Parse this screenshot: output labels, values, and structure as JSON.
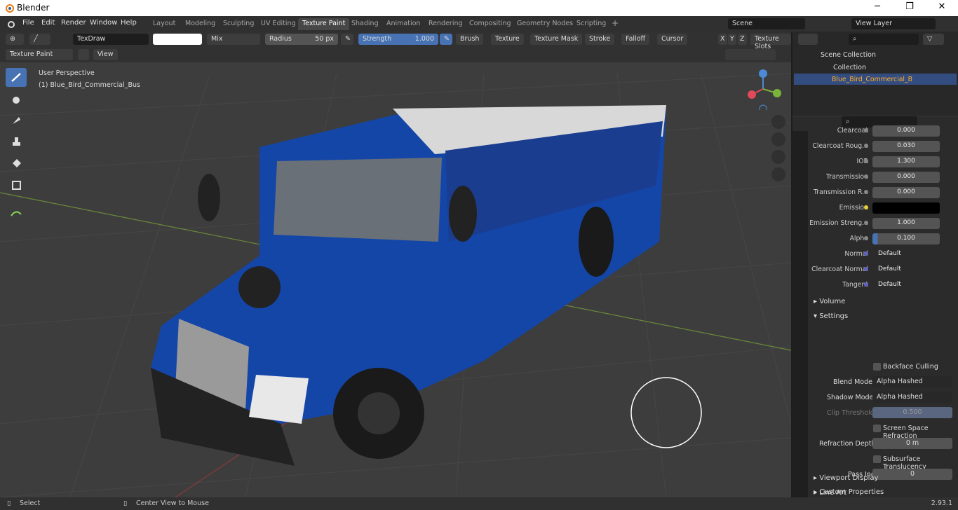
{
  "window": {
    "title": "Blender",
    "min": "─",
    "max": "❐",
    "close": "✕"
  },
  "menu": [
    "File",
    "Edit",
    "Render",
    "Window",
    "Help"
  ],
  "workspaces": [
    "Layout",
    "Modeling",
    "Sculpting",
    "UV Editing",
    "Texture Paint",
    "Shading",
    "Animation",
    "Rendering",
    "Compositing",
    "Geometry Nodes",
    "Scripting",
    "+"
  ],
  "scene": "Scene",
  "view_layer": "View Layer",
  "toolbar": {
    "brush": "TexDraw",
    "blend": "Mix",
    "radius_label": "Radius",
    "radius_value": "50 px",
    "strength_label": "Strength",
    "strength_value": "1.000",
    "strength_fraction": 1.0,
    "menus": [
      "Brush",
      "Texture",
      "Texture Mask",
      "Stroke",
      "Falloff",
      "Cursor"
    ],
    "axes": [
      "X",
      "Y",
      "Z"
    ],
    "texture_slots": "Texture Slots"
  },
  "mode": {
    "label": "Texture Paint",
    "view": "View"
  },
  "viewport": {
    "perspective": "User Perspective",
    "object": "(1) Blue_Bird_Commercial_Bus"
  },
  "outliner": {
    "scene_collection": "Scene Collection",
    "collection": "Collection",
    "object": "Blue_Bird_Commercial_B"
  },
  "props": [
    {
      "label": "Clearcoat",
      "value": "0.000"
    },
    {
      "label": "Clearcoat Roug...",
      "value": "0.030"
    },
    {
      "label": "IOR",
      "value": "1.300"
    },
    {
      "label": "Transmission",
      "value": "0.000"
    },
    {
      "label": "Transmission R...",
      "value": "0.000"
    },
    {
      "label": "Emission",
      "value": ""
    },
    {
      "label": "Emission Streng...",
      "value": "1.000"
    },
    {
      "label": "Alpha",
      "value": "0.100"
    },
    {
      "label": "Normal",
      "value": "Default"
    },
    {
      "label": "Clearcoat Normal",
      "value": "Default"
    },
    {
      "label": "Tangent",
      "value": "Default"
    }
  ],
  "sections": {
    "volume": "Volume",
    "settings": "Settings",
    "line_art": "Line Art",
    "viewport_display": "Viewport Display",
    "custom_props": "Custom Properties"
  },
  "settings": {
    "backface": "Backface Culling",
    "blend_mode_label": "Blend Mode",
    "blend_mode": "Alpha Hashed",
    "shadow_mode_label": "Shadow Mode",
    "shadow_mode": "Alpha Hashed",
    "clip_label": "Clip Threshold",
    "clip_value": "0.500",
    "ssr": "Screen Space Refraction",
    "refr_label": "Refraction Depth",
    "refr_value": "0 m",
    "sss": "Subsurface Translucency",
    "pass_label": "Pass Index",
    "pass_value": "0"
  },
  "status": {
    "select": "Select",
    "center": "Center View to Mouse",
    "version": "2.93.1"
  },
  "colors": {
    "accent": "#4772b3",
    "bus": "#1446a8",
    "active_ws": "#474747"
  }
}
